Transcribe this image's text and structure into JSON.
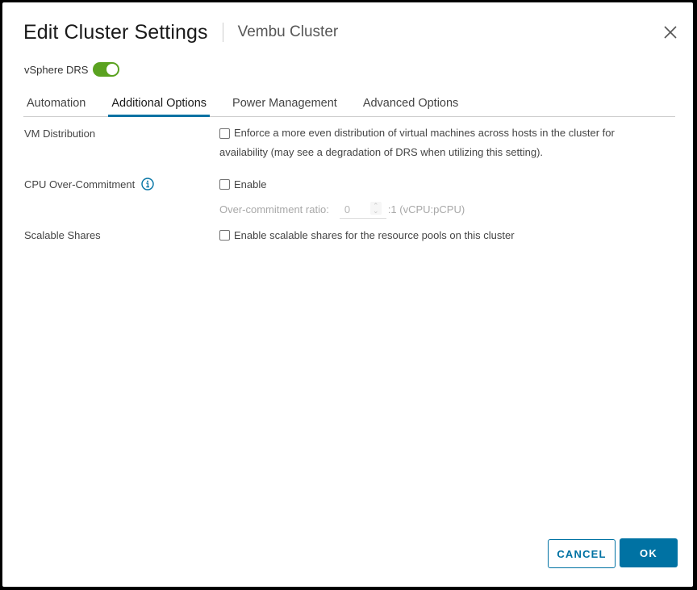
{
  "dialog": {
    "title": "Edit Cluster Settings",
    "subtitle": "Vembu Cluster",
    "close_icon": "close-icon"
  },
  "drs": {
    "label": "vSphere DRS",
    "enabled": true,
    "toggle_color": "#5aa220"
  },
  "tabs": [
    {
      "label": "Automation",
      "active": false
    },
    {
      "label": "Additional Options",
      "active": true
    },
    {
      "label": "Power Management",
      "active": false
    },
    {
      "label": "Advanced Options",
      "active": false
    }
  ],
  "settings": {
    "vm_distribution": {
      "label": "VM Distribution",
      "checkbox_checked": false,
      "checkbox_text_line1": "Enforce a more even distribution of virtual machines across hosts in the cluster for",
      "checkbox_text_line2": "availability (may see a degradation of DRS when utilizing this setting)."
    },
    "cpu_overcommit": {
      "label": "CPU Over-Commitment",
      "info_icon": "info-icon",
      "checkbox_checked": false,
      "checkbox_text": "Enable",
      "ratio_label": "Over-commitment ratio:",
      "ratio_value": "0",
      "ratio_suffix": ":1 (vCPU:pCPU)",
      "ratio_disabled": true
    },
    "scalable_shares": {
      "label": "Scalable Shares",
      "checkbox_checked": false,
      "checkbox_text": "Enable scalable shares for the resource pools on this cluster"
    }
  },
  "footer": {
    "cancel_label": "CANCEL",
    "ok_label": "OK",
    "accent_color": "#0072a3"
  }
}
